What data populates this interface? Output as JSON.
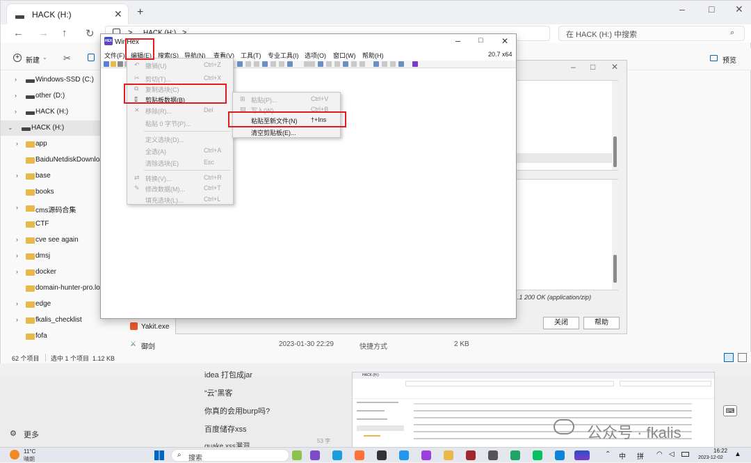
{
  "explorer": {
    "tab_title": "HACK (H:)",
    "new_tab": "+",
    "window_controls": {
      "minimize": "–",
      "maximize": "□",
      "close": "✕"
    },
    "breadcrumb": {
      "sep1": ">",
      "location": "HACK (H:)",
      "sep2": ">"
    },
    "search_placeholder": "在 HACK (H:) 中搜索",
    "toolbar": {
      "new": "新建",
      "preview": "预览"
    },
    "sidebar": [
      {
        "label": "Windows-SSD (C:)",
        "type": "drive",
        "chevron": ">"
      },
      {
        "label": "other (D:)",
        "type": "drive",
        "chevron": ">"
      },
      {
        "label": "HACK (H:)",
        "type": "drive",
        "chevron": ">"
      },
      {
        "label": "HACK (H:)",
        "type": "drive",
        "chevron": "v",
        "selected": true
      },
      {
        "label": "app",
        "type": "folder",
        "chevron": ">"
      },
      {
        "label": "BaiduNetdiskDownload",
        "type": "folder",
        "chevron": ""
      },
      {
        "label": "base",
        "type": "folder",
        "chevron": ">"
      },
      {
        "label": "books",
        "type": "folder",
        "chevron": ""
      },
      {
        "label": "cms源码合集",
        "type": "folder",
        "chevron": ">"
      },
      {
        "label": "CTF",
        "type": "folder",
        "chevron": ""
      },
      {
        "label": "cve see again",
        "type": "folder",
        "chevron": ">"
      },
      {
        "label": "dmsj",
        "type": "folder",
        "chevron": ">"
      },
      {
        "label": "docker",
        "type": "folder",
        "chevron": ">"
      },
      {
        "label": "domain-hunter-pro.log",
        "type": "folder",
        "chevron": ""
      },
      {
        "label": "edge",
        "type": "folder",
        "chevron": ">"
      },
      {
        "label": "fkalis_checklist",
        "type": "folder",
        "chevron": ">"
      },
      {
        "label": "fofa",
        "type": "folder",
        "chevron": ""
      }
    ],
    "files": [
      {
        "name": "Yakit.exe",
        "date": "",
        "type": "",
        "size": ""
      },
      {
        "name": "御剑",
        "date": "2023-01-30 22:29",
        "type": "快捷方式",
        "size": "2 KB"
      }
    ],
    "status": {
      "count": "62 个项目",
      "selected": "选中 1 个项目  1.12 KB"
    }
  },
  "dialog": {
    "status_text": "1.1 200 OK (application/zip)",
    "close_button": "关闭",
    "help_button": "帮助"
  },
  "winhex": {
    "title": "WinHex",
    "version": "20.7 x64",
    "menubar": [
      "文件(F)",
      "编辑(E)",
      "搜索(S)",
      "导航(N)",
      "查看(V)",
      "工具(T)",
      "专业工具(I)",
      "选项(O)",
      "窗口(W)",
      "帮助(H)"
    ]
  },
  "edit_menu": [
    {
      "label": "撤销(U)",
      "shortcut": "Ctrl+Z",
      "disabled": true
    },
    {
      "label": "剪切(T)...",
      "shortcut": "Ctrl+X",
      "disabled": true
    },
    {
      "label": "复制选块(C)",
      "shortcut": "",
      "disabled": true
    },
    {
      "label": "剪贴板数据(B)",
      "shortcut": "",
      "disabled": false
    },
    {
      "label": "移除(R)...",
      "shortcut": "Del",
      "disabled": true
    },
    {
      "label": "粘贴 0 字节(P)...",
      "shortcut": "",
      "disabled": true
    },
    {
      "label": "定义选块(D)...",
      "shortcut": "",
      "disabled": true
    },
    {
      "label": "全选(A)",
      "shortcut": "Ctrl+A",
      "disabled": true
    },
    {
      "label": "清除选块(E)",
      "shortcut": "Esc",
      "disabled": true
    },
    {
      "label": "转换(V)...",
      "shortcut": "Ctrl+R",
      "disabled": true
    },
    {
      "label": "修改数据(M)...",
      "shortcut": "Ctrl+T",
      "disabled": true
    },
    {
      "label": "填充选块(L)...",
      "shortcut": "Ctrl+L",
      "disabled": true
    }
  ],
  "clipboard_submenu": [
    {
      "label": "粘贴(P)...",
      "shortcut": "Ctrl+V",
      "disabled": true
    },
    {
      "label": "写入(W)...",
      "shortcut": "Ctrl+B",
      "disabled": true
    },
    {
      "label": "粘贴至新文件(N)",
      "shortcut": "†+Ins",
      "disabled": false
    },
    {
      "label": "清空剪贴板(E)...",
      "shortcut": "",
      "disabled": false
    }
  ],
  "article": {
    "links": [
      "idea 打包成jar",
      "“云”黑客",
      "你真的会用burp吗?",
      "百度储存xss",
      "quake xss漏洞"
    ],
    "word_count": "53 字",
    "more": "更多",
    "watermark": "公众号 · fkalis"
  },
  "taskbar": {
    "weather_temp": "11°C",
    "weather_desc": "晴朗",
    "search": "搜索",
    "ime_mode": "中",
    "ime_pinyin": "拼",
    "time": "16:22",
    "date": "2023-12-02"
  },
  "colors": {
    "highlight_box": "#e21d1d",
    "folder": "#e8b94a",
    "accent": "#0067c0"
  }
}
